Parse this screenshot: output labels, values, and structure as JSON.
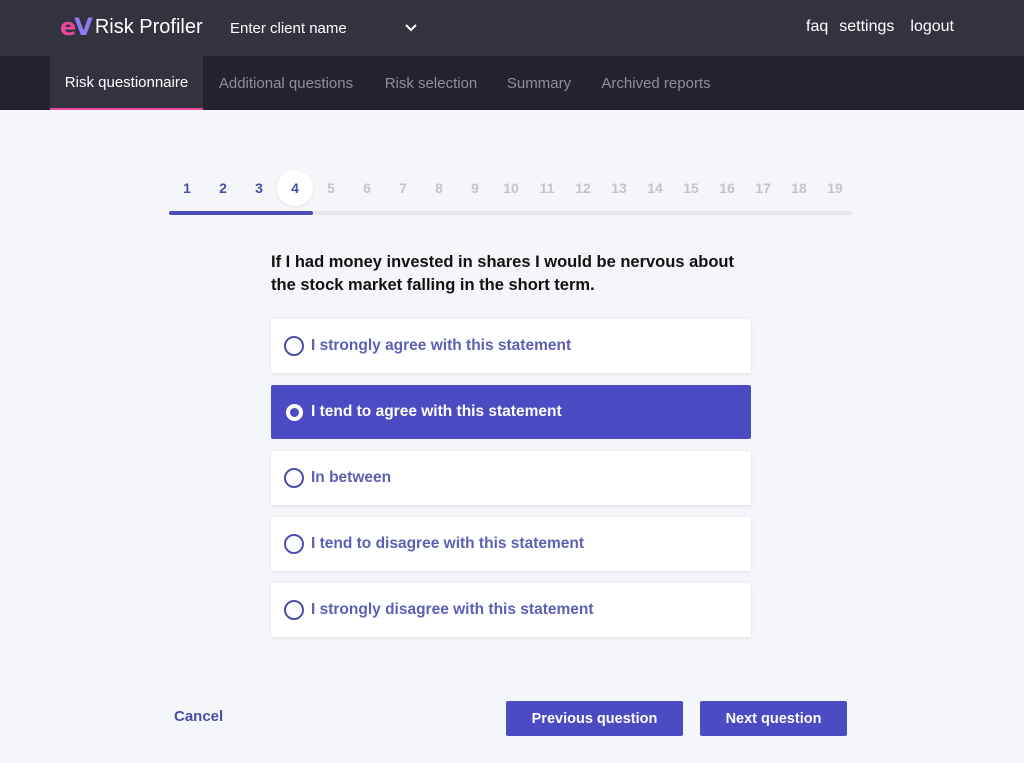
{
  "header": {
    "logo_mark_e": "e",
    "logo_mark_v": "V",
    "app_name": "Risk Profiler",
    "client_select": {
      "value": "Enter client name",
      "icon": "chevron-down-icon"
    },
    "links": {
      "faq": "faq",
      "settings": "settings",
      "logout": "logout"
    }
  },
  "tabs": [
    {
      "label": "Risk questionnaire",
      "active": true
    },
    {
      "label": "Additional questions",
      "active": false
    },
    {
      "label": "Risk selection",
      "active": false
    },
    {
      "label": "Summary",
      "active": false
    },
    {
      "label": "Archived reports",
      "active": false
    }
  ],
  "stepper": {
    "steps": [
      "1",
      "2",
      "3",
      "4",
      "5",
      "6",
      "7",
      "8",
      "9",
      "10",
      "11",
      "12",
      "13",
      "14",
      "15",
      "16",
      "17",
      "18",
      "19"
    ],
    "current": 4,
    "total": 19
  },
  "question": {
    "text": "If I had money invested in shares I would be nervous about the stock market falling in the short term.",
    "options": [
      {
        "label": "I strongly agree with this statement",
        "selected": false
      },
      {
        "label": "I tend to agree with this statement",
        "selected": true
      },
      {
        "label": "In between",
        "selected": false
      },
      {
        "label": "I tend to disagree with this statement",
        "selected": false
      },
      {
        "label": "I strongly disagree with this statement",
        "selected": false
      }
    ]
  },
  "footer": {
    "cancel_label": "Cancel",
    "previous_label": "Previous question",
    "next_label": "Next question"
  },
  "colors": {
    "accent": "#4b4cc4",
    "brand_pink": "#e8479a",
    "topbar": "#33323f",
    "tabbar": "#232330"
  }
}
